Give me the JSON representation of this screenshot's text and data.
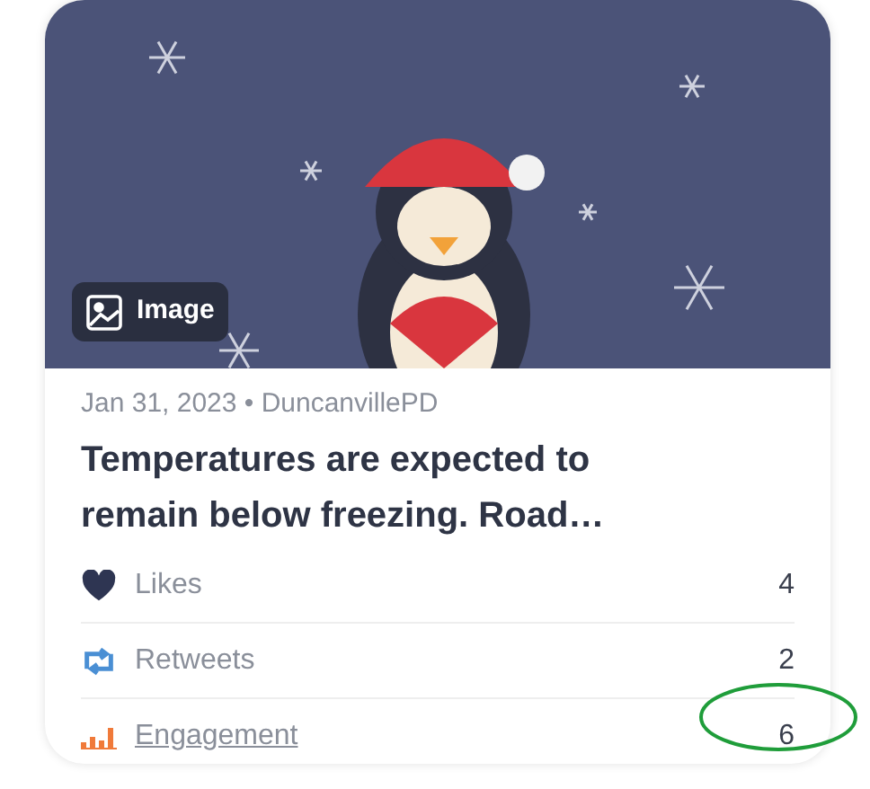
{
  "card": {
    "media": {
      "kind": "picture",
      "badge": "Image"
    },
    "meta": "Jan 31, 2023 • DuncanvillePD",
    "title": "Temperatures are expected to remain below freezing. Road…",
    "stats": [
      {
        "kind": "likes",
        "label": "Likes",
        "value": "4",
        "link": false
      },
      {
        "kind": "retweets",
        "label": "Retweets",
        "value": "2",
        "link": false
      },
      {
        "kind": "engagement",
        "label": "Engagement",
        "value": "6",
        "link": true
      }
    ]
  }
}
